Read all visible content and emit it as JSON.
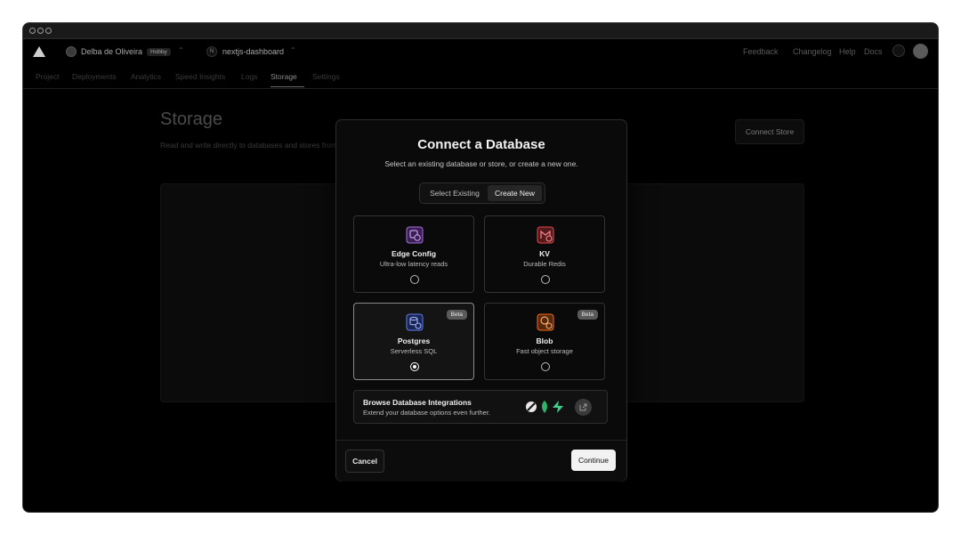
{
  "nav": {
    "user_name": "Delba de Oliveira",
    "plan_badge": "Hobby",
    "project_initial": "N",
    "project_name": "nextjs-dashboard",
    "links": [
      "Feedback",
      "Changelog",
      "Help",
      "Docs"
    ]
  },
  "tabs": [
    "Project",
    "Deployments",
    "Analytics",
    "Speed Insights",
    "Logs",
    "Storage",
    "Settings"
  ],
  "active_tab": "Storage",
  "page": {
    "title": "Storage",
    "subtitle": "Read and write directly to databases and stores from your projects.",
    "connect_store_label": "Connect Store"
  },
  "modal": {
    "title": "Connect a Database",
    "subtitle": "Select an existing database or store, or create a new one.",
    "segment": {
      "options": [
        "Select Existing",
        "Create New"
      ],
      "active": "Create New"
    },
    "cards": [
      {
        "name": "Edge Config",
        "desc": "Ultra-low latency reads",
        "icon": "edge-config-icon",
        "color": "#8e4ec6",
        "selected": false
      },
      {
        "name": "KV",
        "desc": "Durable Redis",
        "icon": "kv-icon",
        "color": "#e5484d",
        "selected": false
      },
      {
        "name": "Postgres",
        "desc": "Serverless SQL",
        "icon": "postgres-icon",
        "color": "#3e63dd",
        "selected": true,
        "badge": "Beta"
      },
      {
        "name": "Blob",
        "desc": "Fast object storage",
        "icon": "blob-icon",
        "color": "#f76b15",
        "selected": false,
        "badge": "Beta"
      }
    ],
    "integrations": {
      "title": "Browse Database Integrations",
      "subtitle": "Extend your database options even further."
    },
    "cancel_label": "Cancel",
    "continue_label": "Continue"
  }
}
